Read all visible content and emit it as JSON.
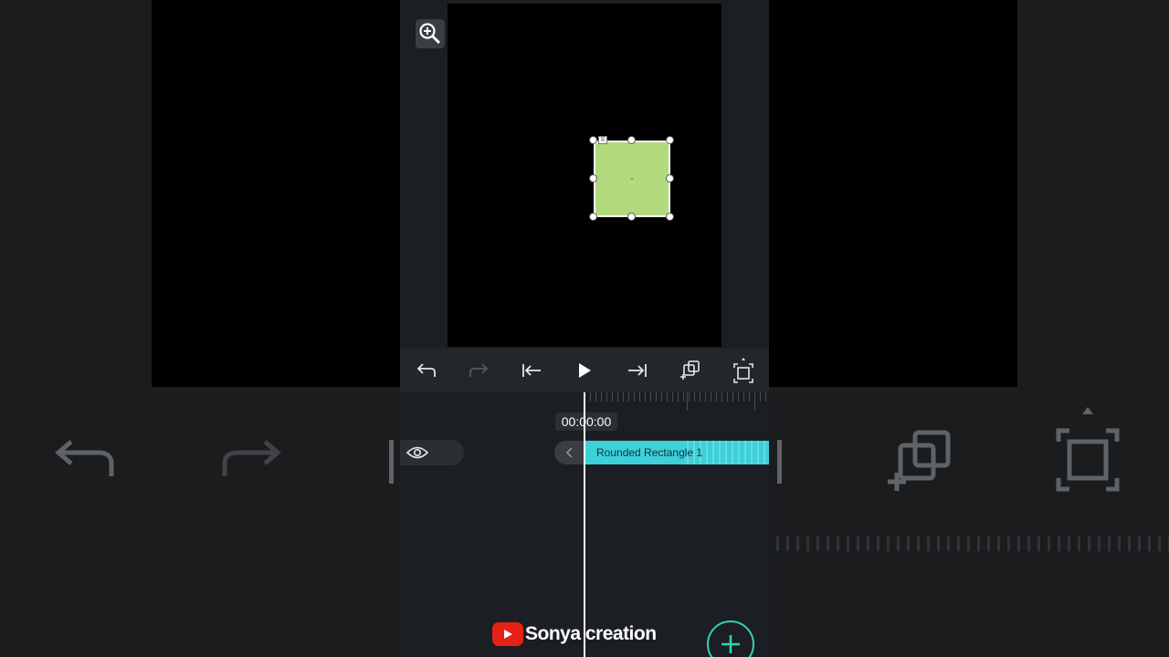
{
  "timeline": {
    "current_time": "00:00:00",
    "clip_label": "Rounded Rectangle 1"
  },
  "shape": {
    "type": "rounded-rectangle",
    "fill_color": "#b3d97f",
    "corner_badge": "II"
  },
  "toolbar": {
    "icons": [
      "undo-icon",
      "redo-icon",
      "skip-to-start-icon",
      "play-icon",
      "skip-to-end-icon",
      "duplicate-icon",
      "fit-to-screen-icon"
    ],
    "redo_enabled": false
  },
  "watermark": {
    "text": "Sonya creation",
    "icon": "youtube-icon"
  },
  "fab": {
    "icon": "plus-icon",
    "accent": "#2fd3b4"
  },
  "colors": {
    "clip": "#3ed0d8",
    "panel": "#1b1e22"
  }
}
